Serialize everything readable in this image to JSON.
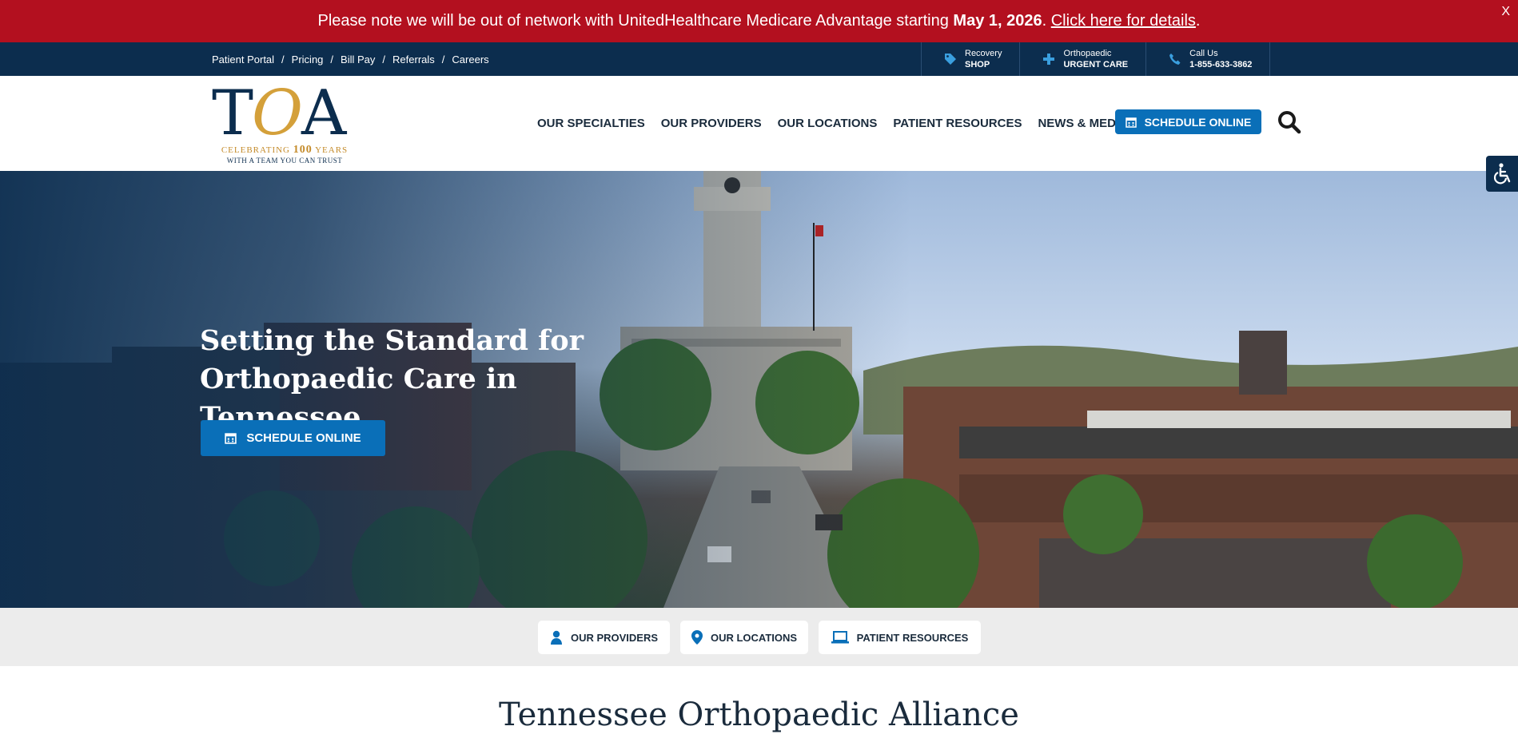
{
  "alert": {
    "text_before": "Please note we will be out of network with UnitedHealthcare Medicare Advantage starting ",
    "date": "May 1, 2026",
    "period": ".",
    "link": "Click here for details",
    "end": ".",
    "close": "X"
  },
  "utility": {
    "links": [
      "Patient Portal",
      "Pricing",
      "Bill Pay",
      "Referrals",
      "Careers"
    ],
    "separator": "/",
    "boxes": [
      {
        "top": "Recovery",
        "bottom": "SHOP",
        "icon": "tag-icon"
      },
      {
        "top": "Orthopaedic",
        "bottom": "URGENT CARE",
        "icon": "plus-icon"
      },
      {
        "top": "Call Us",
        "bottom": "1-855-633-3862",
        "icon": "phone-icon"
      }
    ]
  },
  "header": {
    "logo": {
      "mark_t": "T",
      "mark_o": "O",
      "mark_a": "A",
      "line1_a": "CELEBRATING ",
      "line1_b": "100",
      "line1_c": " YEARS",
      "line2": "WITH A TEAM YOU CAN TRUST"
    },
    "nav": [
      "OUR SPECIALTIES",
      "OUR PROVIDERS",
      "OUR LOCATIONS",
      "PATIENT RESOURCES",
      "NEWS & MEDIA"
    ],
    "schedule_label": "SCHEDULE ONLINE"
  },
  "hero": {
    "title_line1": "Setting the Standard for",
    "title_line2": "Orthopaedic Care in Tennessee",
    "button": "SCHEDULE ONLINE"
  },
  "quick_links": [
    {
      "label": "OUR PROVIDERS",
      "icon": "user-icon"
    },
    {
      "label": "OUR LOCATIONS",
      "icon": "map-pin-icon"
    },
    {
      "label": "PATIENT RESOURCES",
      "icon": "laptop-icon"
    }
  ],
  "main": {
    "title": "Tennessee Orthopaedic Alliance"
  },
  "colors": {
    "alert": "#b3101f",
    "navy": "#0c2d4e",
    "accent": "#0a6fb8",
    "gold": "#d4a03a"
  }
}
